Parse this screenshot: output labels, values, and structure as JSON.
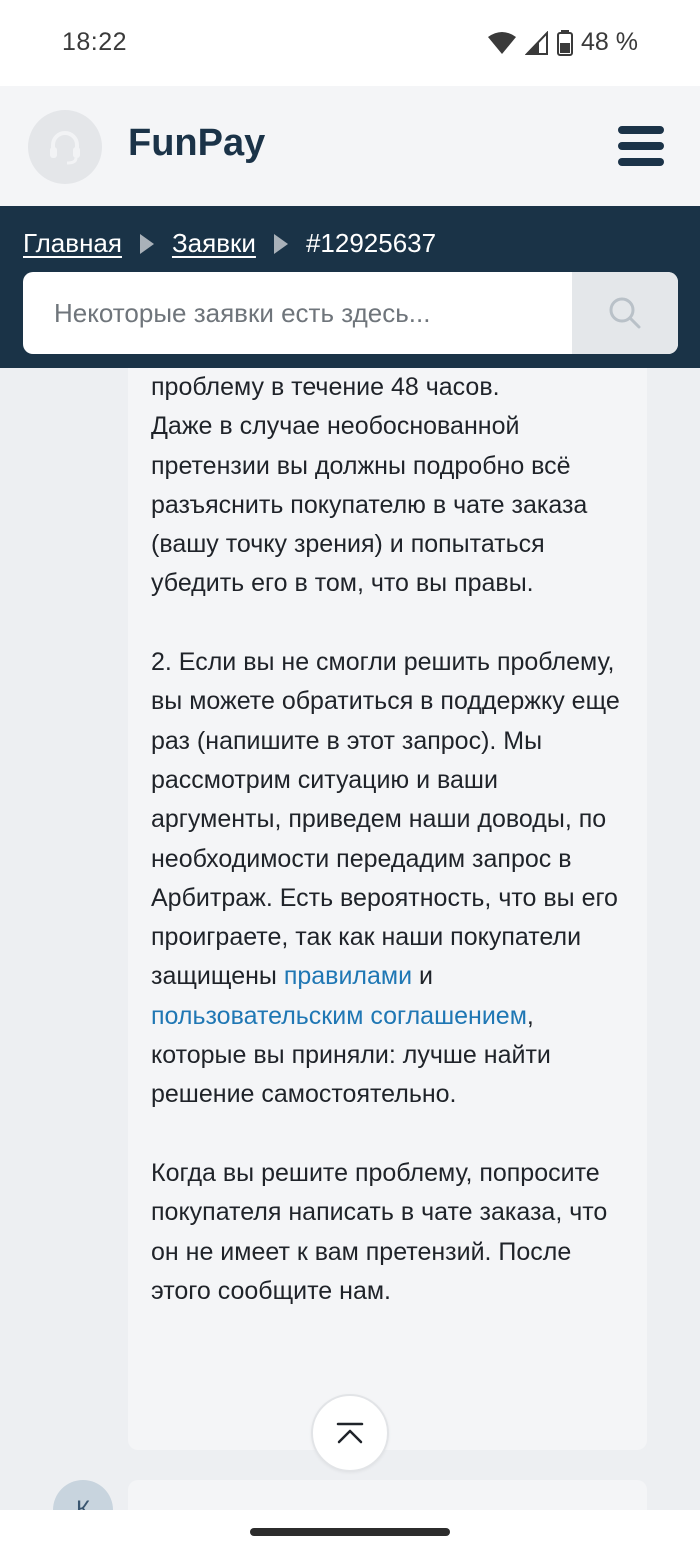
{
  "status_bar": {
    "time": "18:22",
    "battery": "48 %"
  },
  "header": {
    "brand": "FunPay"
  },
  "breadcrumb": {
    "home": "Главная",
    "requests": "Заявки",
    "current": "#12925637"
  },
  "search": {
    "placeholder": "Некоторые заявки есть здесь..."
  },
  "message": {
    "p1": "проблему в течение 48 часов.",
    "p2": "Даже в случае необоснованной претензии вы должны подробно всё разъяснить покупателю в чате заказа (вашу точку зрения) и попытаться убедить его в том, что вы правы.",
    "p3_start": "2. Если вы не смогли решить проблему, вы можете обратиться в поддержку еще раз (напишите в этот запрос). Мы рассмотрим ситуацию и ваши аргументы, приведем наши доводы, по необходимости передадим запрос в Арбитраж. Есть вероятность, что вы его проиграете, так как наши покупатели защищены",
    "link_rules": "правилами",
    "and": "и",
    "link_agreement": "пользовательским соглашением",
    "p3_end": ", которые вы приняли: лучше найти решение самостоятельно.",
    "p4": "Когда вы решите проблему, попросите покупателя написать в чате заказа, что он не имеет к вам претензий.  После этого сообщите нам."
  },
  "next_message": {
    "avatar_letter": "К"
  },
  "colors": {
    "navy": "#1a3347",
    "link": "#1f77b4",
    "bubble": "#f4f5f7"
  }
}
